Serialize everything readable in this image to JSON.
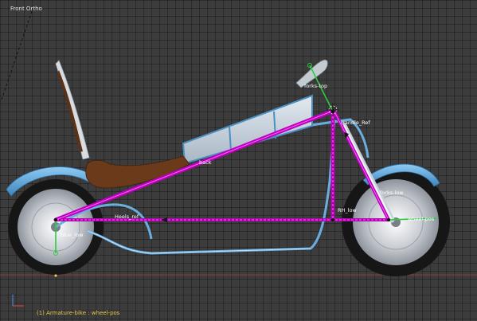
{
  "viewport": {
    "view_name": "Front Ortho",
    "status_text": "(1) Armature-bike : wheel-pos"
  },
  "bone_labels": {
    "forks_top": "forks-top",
    "handle_ref": "Handle_Ref",
    "back": "back",
    "forks_low": "forks-low",
    "heels_ref": "Heels_ref",
    "rh_low": "RH_low",
    "wheel_pos": "wheel-pos",
    "blue_low": "blue_low"
  },
  "colors": {
    "background": "#3c3c3c",
    "grid_line": "#2e2e2e",
    "axis_red": "#8a4040",
    "bone_selected": "#c000c0",
    "bone_active": "#2ecc40",
    "frame_blue": "#6aaee0",
    "tank_silver": "#c9d4de",
    "seat_brown": "#6b3a1a",
    "status_text": "#e8c84a"
  }
}
